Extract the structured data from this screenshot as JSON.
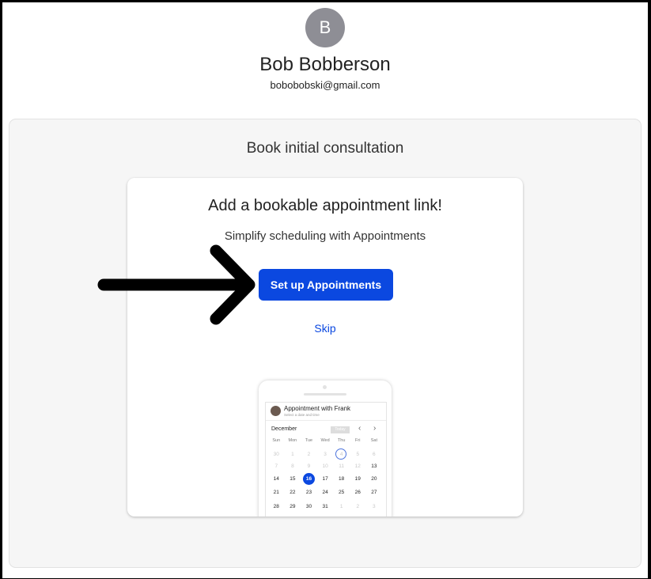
{
  "user": {
    "avatar_letter": "B",
    "name": "Bob Bobberson",
    "email": "bobobobski@gmail.com"
  },
  "panel": {
    "title": "Book initial consultation"
  },
  "card": {
    "title": "Add a bookable appointment link!",
    "subtitle": "Simplify scheduling with Appointments",
    "setup_button": "Set up Appointments",
    "skip_link": "Skip"
  },
  "preview": {
    "title": "Appointment with Frank",
    "subtitle": "Select a date and time",
    "month": "December",
    "today": "Today",
    "weekdays": [
      "Sun",
      "Mon",
      "Tue",
      "Wed",
      "Thu",
      "Fri",
      "Sat"
    ],
    "weeks": [
      [
        "30",
        "1",
        "2",
        "3",
        "4",
        "5",
        "6"
      ],
      [
        "7",
        "8",
        "9",
        "10",
        "11",
        "12",
        "13"
      ],
      [
        "14",
        "15",
        "16",
        "17",
        "18",
        "19",
        "20"
      ],
      [
        "21",
        "22",
        "23",
        "24",
        "25",
        "26",
        "27"
      ],
      [
        "28",
        "29",
        "30",
        "31",
        "1",
        "2",
        "3"
      ]
    ],
    "selected_day": "16",
    "today_day": "4"
  },
  "colors": {
    "accent": "#0b48e0",
    "avatar_bg": "#8e8e95",
    "panel_bg": "#f6f6f6"
  }
}
